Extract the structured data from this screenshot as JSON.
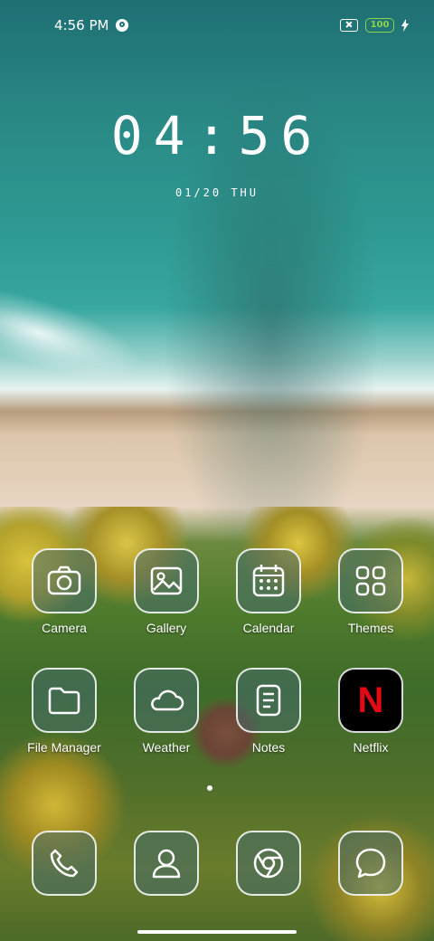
{
  "status_bar": {
    "time": "4:56 PM",
    "battery": "100"
  },
  "clock": {
    "time": "04:56",
    "date": "01/20 THU"
  },
  "apps": [
    {
      "label": "Camera",
      "icon": "camera-icon"
    },
    {
      "label": "Gallery",
      "icon": "gallery-icon"
    },
    {
      "label": "Calendar",
      "icon": "calendar-icon"
    },
    {
      "label": "Themes",
      "icon": "themes-icon"
    },
    {
      "label": "File Manager",
      "icon": "folder-icon"
    },
    {
      "label": "Weather",
      "icon": "cloud-icon"
    },
    {
      "label": "Notes",
      "icon": "notes-icon"
    },
    {
      "label": "Netflix",
      "icon": "netflix-logo"
    }
  ],
  "dock": [
    {
      "icon": "phone-icon"
    },
    {
      "icon": "contacts-icon"
    },
    {
      "icon": "chrome-icon"
    },
    {
      "icon": "messages-icon"
    }
  ],
  "netflix_letter": "N",
  "colors": {
    "battery": "#8bd34b",
    "netflix_red": "#e50914"
  }
}
